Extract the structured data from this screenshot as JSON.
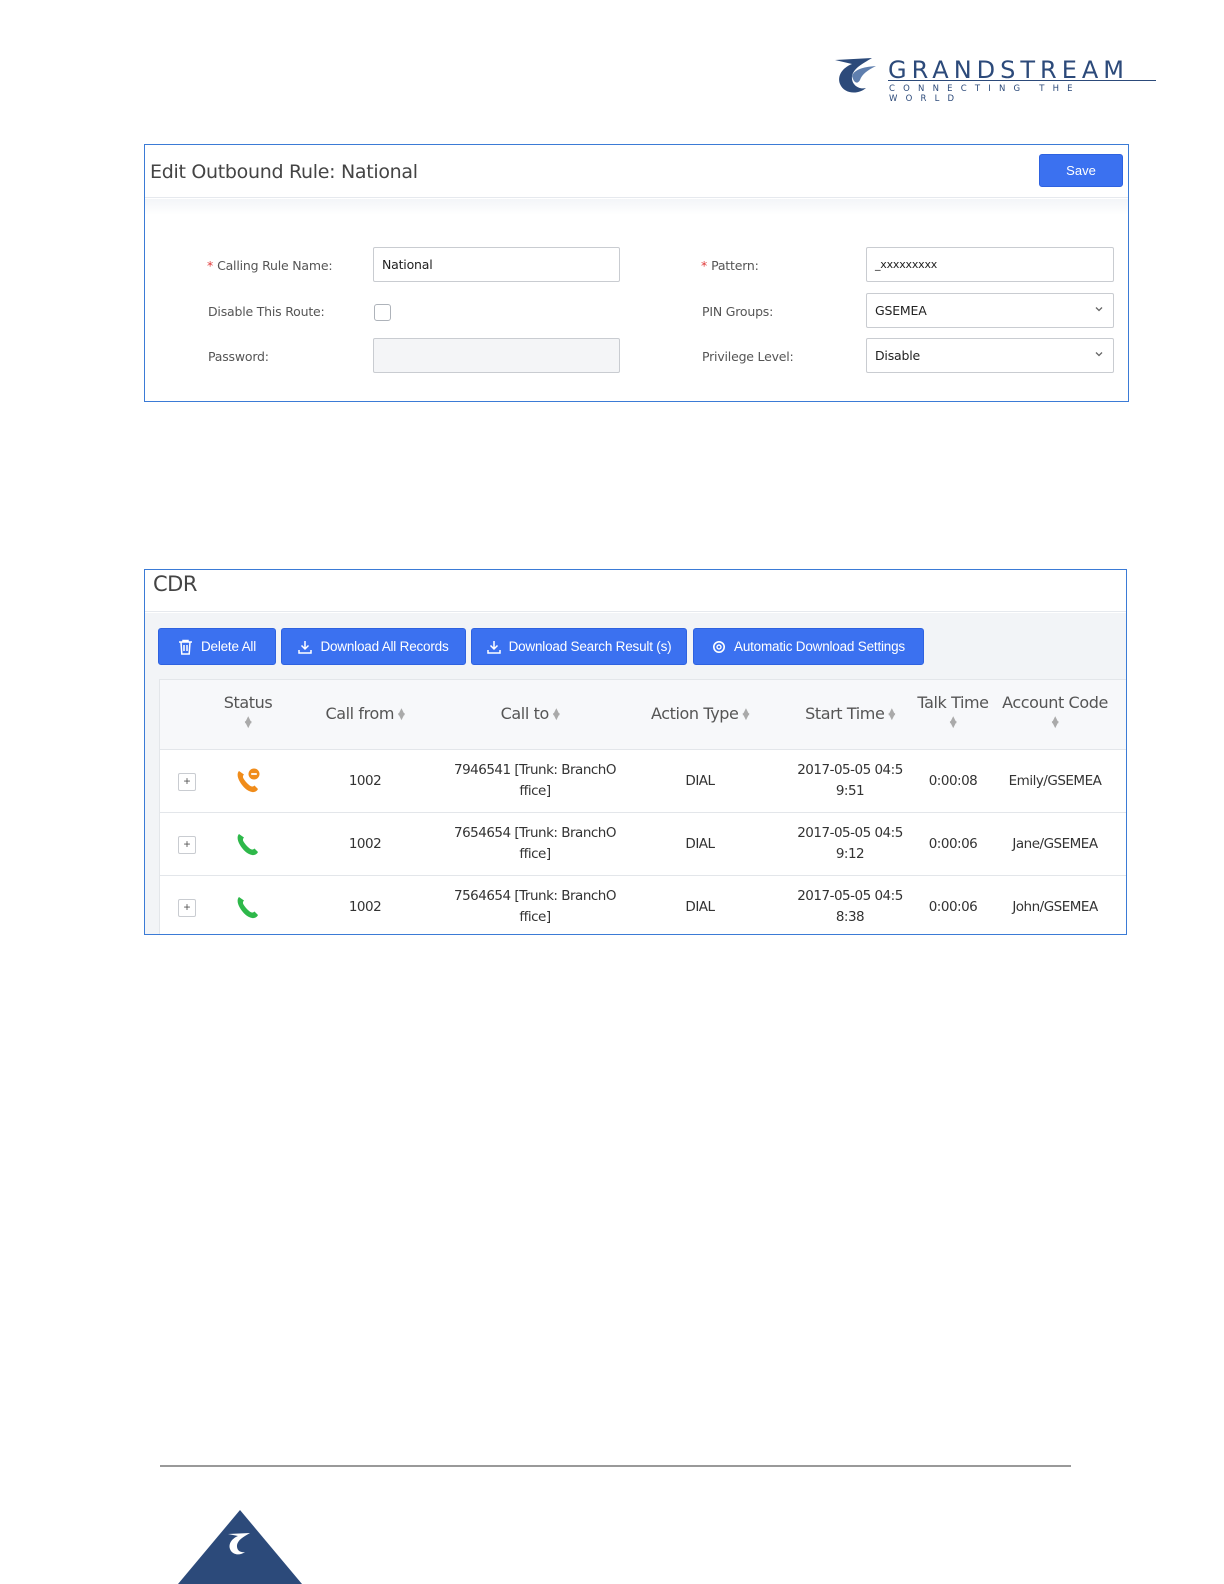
{
  "brand": {
    "name": "GRANDSTREAM",
    "tagline": "CONNECTING THE WORLD",
    "primary_color": "#2c4a7a",
    "icon": "grandstream-logo-icon"
  },
  "rule_panel": {
    "title": "Edit Outbound Rule: National",
    "save_label": "Save",
    "required_mark": "*",
    "fields": {
      "calling_rule_name": {
        "label": "Calling Rule Name:",
        "value": "National"
      },
      "disable_route": {
        "label": "Disable This Route:",
        "checked": false
      },
      "password": {
        "label": "Password:",
        "value": ""
      },
      "pattern": {
        "label": "Pattern:",
        "value": "_xxxxxxxxx"
      },
      "pin_groups": {
        "label": "PIN Groups:",
        "value": "GSEMEA"
      },
      "privilege_level": {
        "label": "Privilege Level:",
        "value": "Disable"
      }
    }
  },
  "cdr": {
    "title": "CDR",
    "accent_color": "#3b71f0",
    "buttons": {
      "delete_all": "Delete All",
      "download_all": "Download All Records",
      "download_search": "Download Search Result (s)",
      "auto_download": "Automatic Download Settings"
    },
    "columns": {
      "status": "Status",
      "call_from": "Call from",
      "call_to": "Call to",
      "action_type": "Action Type",
      "start_time": "Start Time",
      "talk_time": "Talk Time",
      "account_code": "Account Code"
    },
    "rows": [
      {
        "expand": "+",
        "status_icon": "phone-missed-icon",
        "status_color": "#f08c1a",
        "call_from": "1002",
        "call_to_1": "7946541 [Trunk: BranchO",
        "call_to_2": "ffice]",
        "action_type": "DIAL",
        "start_time_1": "2017-05-05 04:5",
        "start_time_2": "9:51",
        "talk_time": "0:00:08",
        "account_code": "Emily/GSEMEA"
      },
      {
        "expand": "+",
        "status_icon": "phone-answered-icon",
        "status_color": "#2eb84a",
        "call_from": "1002",
        "call_to_1": "7654654 [Trunk: BranchO",
        "call_to_2": "ffice]",
        "action_type": "DIAL",
        "start_time_1": "2017-05-05 04:5",
        "start_time_2": "9:12",
        "talk_time": "0:00:06",
        "account_code": "Jane/GSEMEA"
      },
      {
        "expand": "+",
        "status_icon": "phone-answered-icon",
        "status_color": "#2eb84a",
        "call_from": "1002",
        "call_to_1": "7564654 [Trunk: BranchO",
        "call_to_2": "ffice]",
        "action_type": "DIAL",
        "start_time_1": "2017-05-05 04:5",
        "start_time_2": "8:38",
        "talk_time": "0:00:06",
        "account_code": "John/GSEMEA"
      }
    ]
  }
}
